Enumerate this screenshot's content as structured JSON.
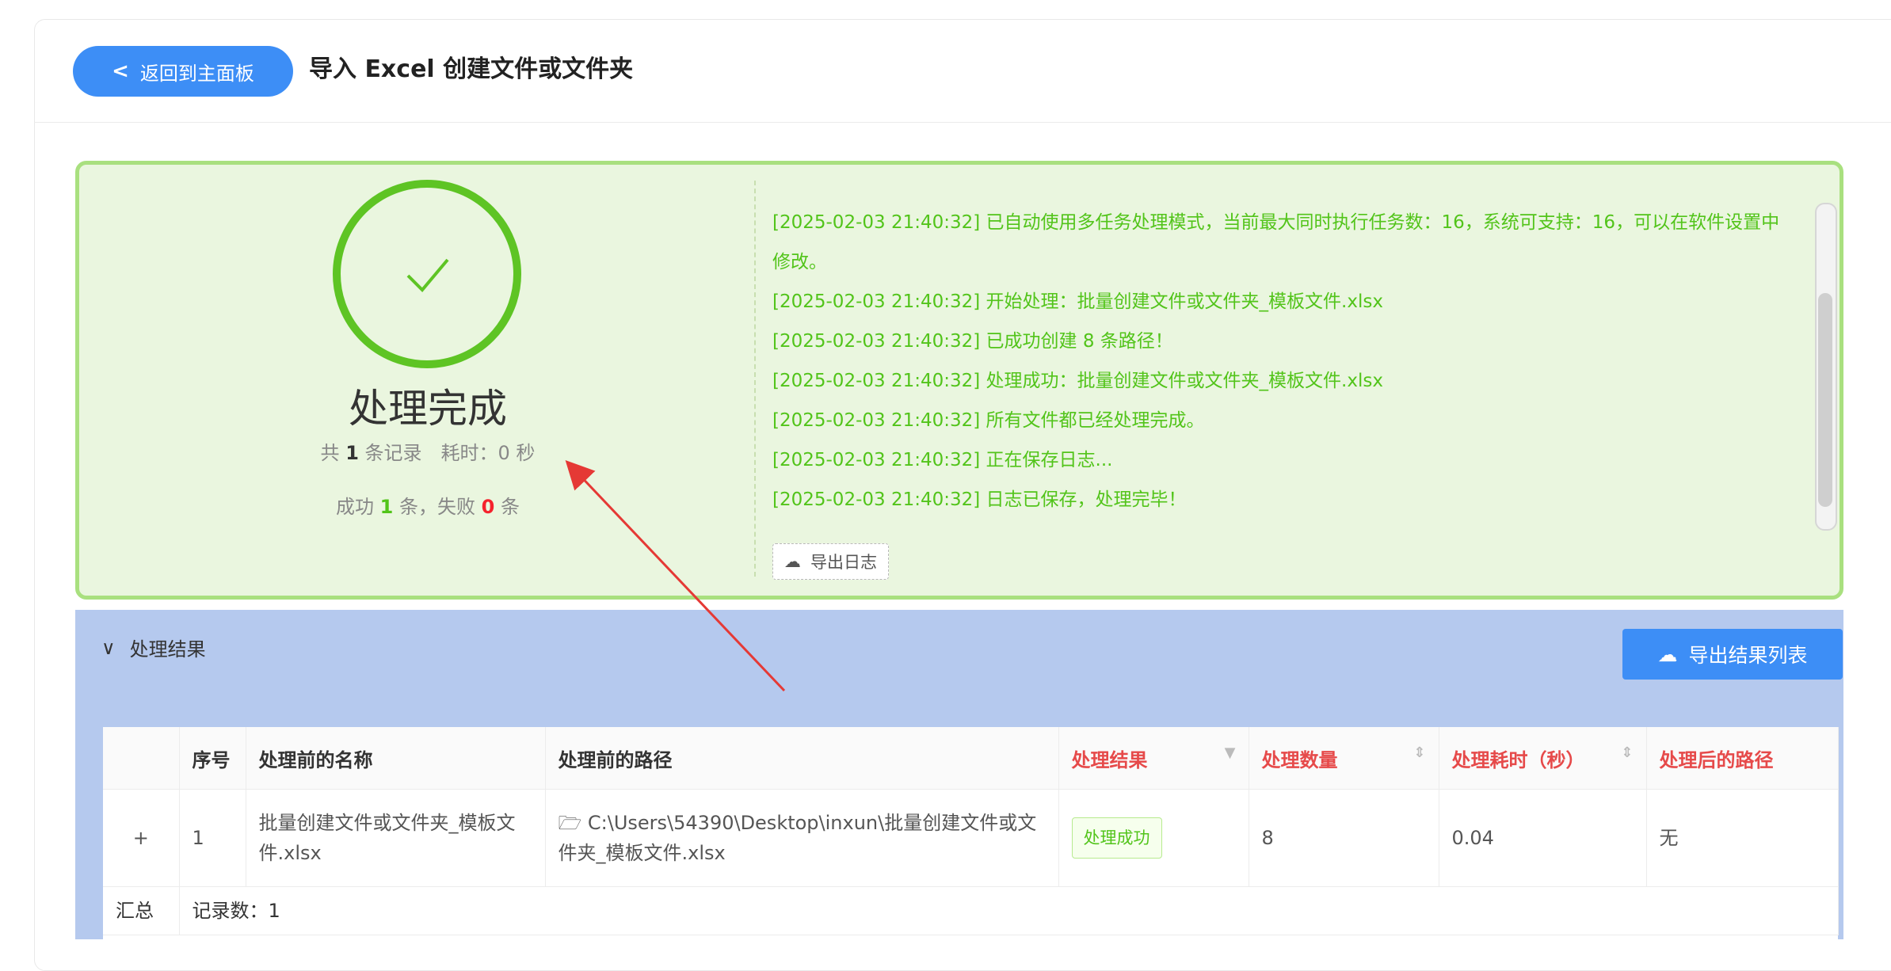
{
  "header": {
    "back_label": "返回到主面板",
    "title": "导入 Excel 创建文件或文件夹"
  },
  "status": {
    "title": "处理完成",
    "total_prefix": "共",
    "total_count": "1",
    "total_suffix": "条记录　耗时：0 秒",
    "success_prefix": "成功",
    "success_count": "1",
    "success_mid": "条，失败",
    "fail_count": "0",
    "fail_suffix": "条"
  },
  "log": {
    "lines": [
      "[2025-02-03 21:40:32] 已自动使用多任务处理模式，当前最大同时执行任务数：16，系统可支持：16，可以在软件设置中修改。",
      "[2025-02-03 21:40:32] 开始处理：批量创建文件或文件夹_模板文件.xlsx",
      "[2025-02-03 21:40:32] 已成功创建 8 条路径！",
      "[2025-02-03 21:40:32] 处理成功：批量创建文件或文件夹_模板文件.xlsx",
      "[2025-02-03 21:40:32] 所有文件都已经处理完成。",
      "[2025-02-03 21:40:32] 正在保存日志...",
      "[2025-02-03 21:40:32] 日志已保存，处理完毕！"
    ],
    "export_label": "导出日志"
  },
  "results": {
    "section_label": "处理结果",
    "export_label": "导出结果列表",
    "columns": [
      "序号",
      "处理前的名称",
      "处理前的路径",
      "处理结果",
      "处理数量",
      "处理耗时（秒）",
      "处理后的路径"
    ],
    "rows": [
      {
        "expand": "+",
        "index": "1",
        "name": "批量创建文件或文件夹_模板文件.xlsx",
        "path": "C:\\Users\\54390\\Desktop\\inxun\\批量创建文件或文件夹_模板文件.xlsx",
        "result": "处理成功",
        "count": "8",
        "time": "0.04",
        "after_path": "无"
      }
    ],
    "summary_label": "汇总",
    "summary_value": "记录数：1"
  },
  "colors": {
    "accent": "#3d8ef6",
    "success": "#52c41a",
    "danger": "#f5222d",
    "panel": "#eaf6df"
  }
}
